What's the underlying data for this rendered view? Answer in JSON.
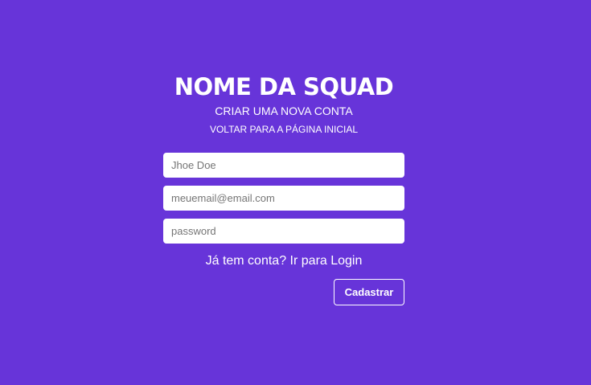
{
  "header": {
    "title": "NOME DA SQUAD",
    "subtitle": "CRIAR UMA NOVA CONTA",
    "back_link": "VOLTAR PARA A PÁGINA INICIAL"
  },
  "form": {
    "name_placeholder": "Jhoe Doe",
    "email_placeholder": "meuemail@email.com",
    "password_placeholder": "password",
    "login_prompt": "Já tem conta?",
    "login_link": "Ir para Login",
    "submit_label": "Cadastrar"
  },
  "colors": {
    "background": "#6734d9",
    "text": "#ffffff",
    "input_background": "#ffffff"
  }
}
